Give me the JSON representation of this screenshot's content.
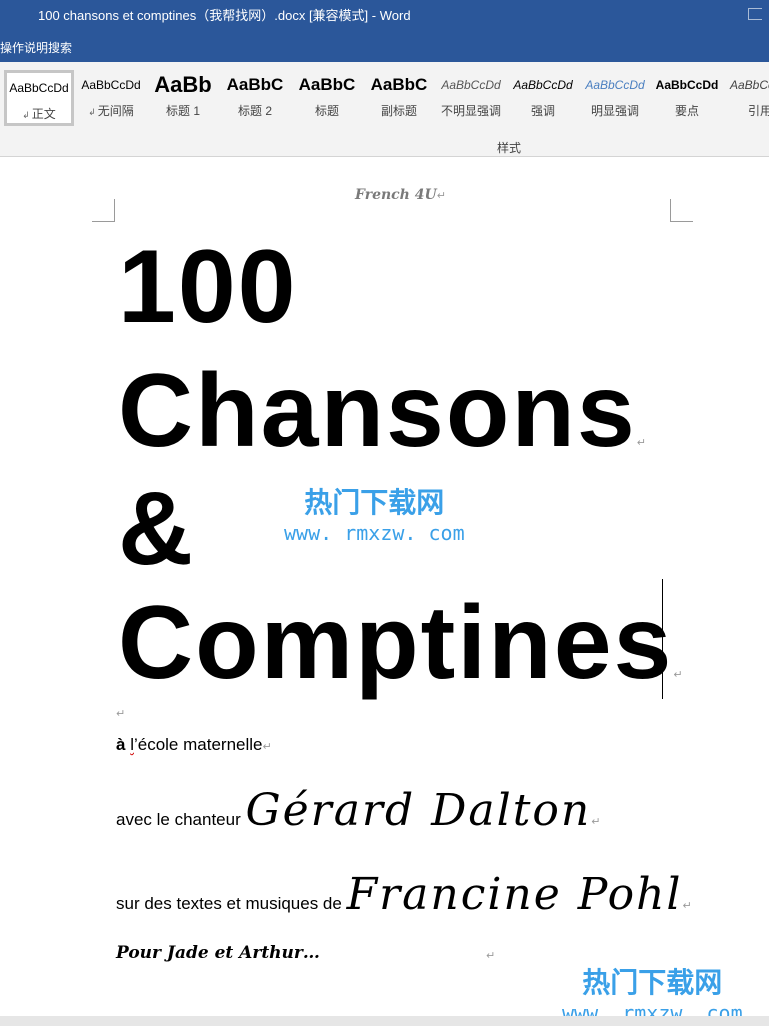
{
  "window": {
    "title": "100 chansons et comptines（我帮找网）.docx [兼容模式]  -  Word",
    "tell_me": "操作说明搜索"
  },
  "ribbon": {
    "group_label": "样式",
    "styles": [
      {
        "sample": "AaBbCcDd",
        "label": "正文",
        "mark": "↲",
        "selected": true
      },
      {
        "sample": "AaBbCcDd",
        "label": "无间隔",
        "mark": "↲",
        "selected": false
      },
      {
        "sample": "AaBb",
        "label": "标题 1",
        "mark": "",
        "selected": false
      },
      {
        "sample": "AaBbC",
        "label": "标题 2",
        "mark": "",
        "selected": false
      },
      {
        "sample": "AaBbC",
        "label": "标题",
        "mark": "",
        "selected": false
      },
      {
        "sample": "AaBbC",
        "label": "副标题",
        "mark": "",
        "selected": false
      },
      {
        "sample": "AaBbCcDd",
        "label": "不明显强调",
        "mark": "",
        "selected": false
      },
      {
        "sample": "AaBbCcDd",
        "label": "强调",
        "mark": "",
        "selected": false
      },
      {
        "sample": "AaBbCcDd",
        "label": "明显强调",
        "mark": "",
        "selected": false
      },
      {
        "sample": "AaBbCcDd",
        "label": "要点",
        "mark": "",
        "selected": false
      },
      {
        "sample": "AaBbCc",
        "label": "引用",
        "mark": "",
        "selected": false
      }
    ]
  },
  "document": {
    "header": "French 4U",
    "title_lines": [
      "100",
      "Chansons",
      "&",
      "Comptines"
    ],
    "line_ecole": {
      "prefix": "à  ",
      "flagged": "l",
      "rest": "’école maternelle"
    },
    "line_chanteur": {
      "text": "avec le chanteur ",
      "name": "Gérard Dalton"
    },
    "line_textes": {
      "text": "sur des textes et musiques de ",
      "name": "Francine Pohl"
    },
    "line_pour": "Pour Jade et Arthur…",
    "paragraph_mark": "↵"
  },
  "watermarks": [
    {
      "cn": "热门下载网",
      "url": "www. rmxzw. com"
    },
    {
      "cn": "热门下载网",
      "url": "www. rmxzw. com"
    }
  ],
  "colors": {
    "title_bar": "#2b579a",
    "ribbon_bg": "#f3f3f3",
    "watermark": "#3aa0e8"
  }
}
